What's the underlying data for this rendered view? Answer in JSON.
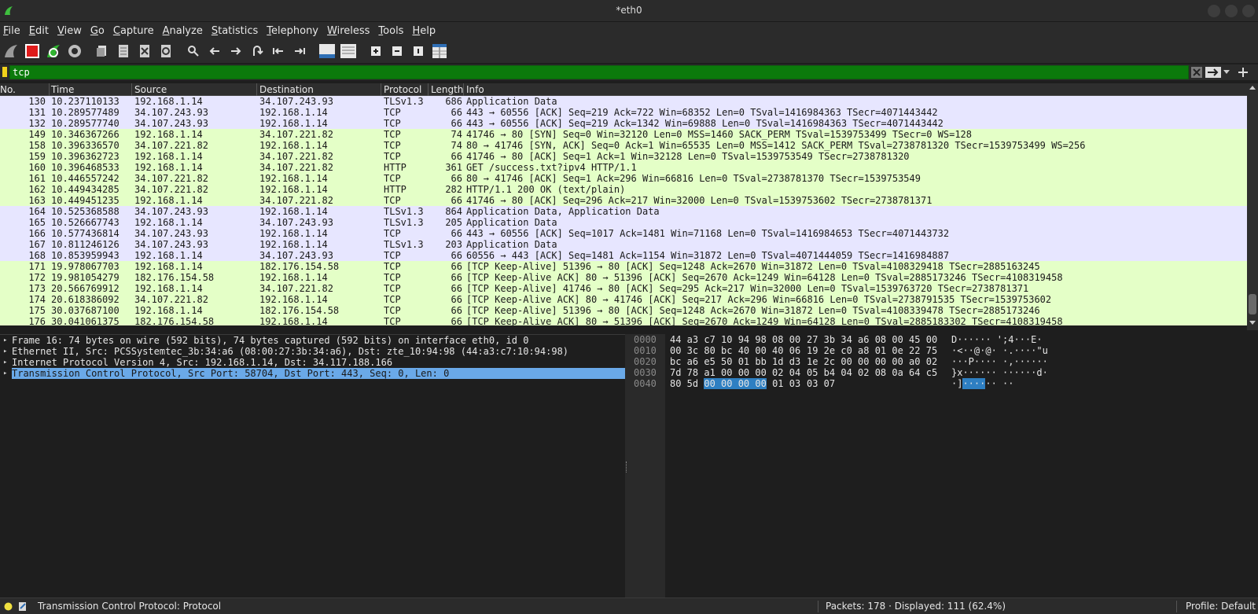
{
  "window": {
    "title": "*eth0"
  },
  "menu": [
    "File",
    "Edit",
    "View",
    "Go",
    "Capture",
    "Analyze",
    "Statistics",
    "Telephony",
    "Wireless",
    "Tools",
    "Help"
  ],
  "menu_underline_index": [
    0,
    0,
    0,
    0,
    0,
    0,
    0,
    0,
    0,
    0,
    0
  ],
  "toolbar": {
    "icons": [
      "shark-fin-start-icon",
      "stop-capture-icon",
      "restart-capture-icon",
      "capture-options-icon",
      "open-file-icon",
      "save-file-icon",
      "close-file-icon",
      "reload-file-icon",
      "find-packet-icon",
      "go-back-icon",
      "go-forward-icon",
      "go-to-packet-icon",
      "go-first-icon",
      "go-last-icon",
      "autoscroll-icon",
      "colorize-icon",
      "zoom-in-icon",
      "zoom-out-icon",
      "normal-size-icon",
      "resize-columns-icon"
    ]
  },
  "filter": {
    "value": "tcp"
  },
  "packet_list": {
    "columns": [
      "No.",
      "Time",
      "Source",
      "Destination",
      "Protocol",
      "Length",
      "Info"
    ],
    "rows": [
      {
        "no": "130",
        "time": "10.237110133",
        "src": "192.168.1.14",
        "dst": "34.107.243.93",
        "proto": "TLSv1.3",
        "len": "686",
        "info": "Application Data",
        "color": "#e7e6ff"
      },
      {
        "no": "131",
        "time": "10.289577489",
        "src": "34.107.243.93",
        "dst": "192.168.1.14",
        "proto": "TCP",
        "len": "66",
        "info": "443 → 60556 [ACK] Seq=219 Ack=722 Win=68352 Len=0 TSval=1416984363 TSecr=4071443442",
        "color": "#e7e6ff"
      },
      {
        "no": "132",
        "time": "10.289577740",
        "src": "34.107.243.93",
        "dst": "192.168.1.14",
        "proto": "TCP",
        "len": "66",
        "info": "443 → 60556 [ACK] Seq=219 Ack=1342 Win=69888 Len=0 TSval=1416984363 TSecr=4071443442",
        "color": "#e7e6ff"
      },
      {
        "no": "149",
        "time": "10.346367266",
        "src": "192.168.1.14",
        "dst": "34.107.221.82",
        "proto": "TCP",
        "len": "74",
        "info": "41746 → 80 [SYN] Seq=0 Win=32120 Len=0 MSS=1460 SACK_PERM TSval=1539753499 TSecr=0 WS=128",
        "color": "#e4ffc7"
      },
      {
        "no": "158",
        "time": "10.396336570",
        "src": "34.107.221.82",
        "dst": "192.168.1.14",
        "proto": "TCP",
        "len": "74",
        "info": "80 → 41746 [SYN, ACK] Seq=0 Ack=1 Win=65535 Len=0 MSS=1412 SACK_PERM TSval=2738781320 TSecr=1539753499 WS=256",
        "color": "#e4ffc7"
      },
      {
        "no": "159",
        "time": "10.396362723",
        "src": "192.168.1.14",
        "dst": "34.107.221.82",
        "proto": "TCP",
        "len": "66",
        "info": "41746 → 80 [ACK] Seq=1 Ack=1 Win=32128 Len=0 TSval=1539753549 TSecr=2738781320",
        "color": "#e4ffc7"
      },
      {
        "no": "160",
        "time": "10.396468533",
        "src": "192.168.1.14",
        "dst": "34.107.221.82",
        "proto": "HTTP",
        "len": "361",
        "info": "GET /success.txt?ipv4 HTTP/1.1",
        "color": "#e4ffc7"
      },
      {
        "no": "161",
        "time": "10.446557242",
        "src": "34.107.221.82",
        "dst": "192.168.1.14",
        "proto": "TCP",
        "len": "66",
        "info": "80 → 41746 [ACK] Seq=1 Ack=296 Win=66816 Len=0 TSval=2738781370 TSecr=1539753549",
        "color": "#e4ffc7"
      },
      {
        "no": "162",
        "time": "10.449434285",
        "src": "34.107.221.82",
        "dst": "192.168.1.14",
        "proto": "HTTP",
        "len": "282",
        "info": "HTTP/1.1 200 OK  (text/plain)",
        "color": "#e4ffc7"
      },
      {
        "no": "163",
        "time": "10.449451235",
        "src": "192.168.1.14",
        "dst": "34.107.221.82",
        "proto": "TCP",
        "len": "66",
        "info": "41746 → 80 [ACK] Seq=296 Ack=217 Win=32000 Len=0 TSval=1539753602 TSecr=2738781371",
        "color": "#e4ffc7"
      },
      {
        "no": "164",
        "time": "10.525368588",
        "src": "34.107.243.93",
        "dst": "192.168.1.14",
        "proto": "TLSv1.3",
        "len": "864",
        "info": "Application Data, Application Data",
        "color": "#e7e6ff"
      },
      {
        "no": "165",
        "time": "10.526667743",
        "src": "192.168.1.14",
        "dst": "34.107.243.93",
        "proto": "TLSv1.3",
        "len": "205",
        "info": "Application Data",
        "color": "#e7e6ff"
      },
      {
        "no": "166",
        "time": "10.577436814",
        "src": "34.107.243.93",
        "dst": "192.168.1.14",
        "proto": "TCP",
        "len": "66",
        "info": "443 → 60556 [ACK] Seq=1017 Ack=1481 Win=71168 Len=0 TSval=1416984653 TSecr=4071443732",
        "color": "#e7e6ff"
      },
      {
        "no": "167",
        "time": "10.811246126",
        "src": "34.107.243.93",
        "dst": "192.168.1.14",
        "proto": "TLSv1.3",
        "len": "203",
        "info": "Application Data",
        "color": "#e7e6ff"
      },
      {
        "no": "168",
        "time": "10.853959943",
        "src": "192.168.1.14",
        "dst": "34.107.243.93",
        "proto": "TCP",
        "len": "66",
        "info": "60556 → 443 [ACK] Seq=1481 Ack=1154 Win=31872 Len=0 TSval=4071444059 TSecr=1416984887",
        "color": "#e7e6ff"
      },
      {
        "no": "171",
        "time": "19.978067703",
        "src": "192.168.1.14",
        "dst": "182.176.154.58",
        "proto": "TCP",
        "len": "66",
        "info": "[TCP Keep-Alive] 51396 → 80 [ACK] Seq=1248 Ack=2670 Win=31872 Len=0 TSval=4108329418 TSecr=2885163245",
        "color": "#e4ffc7"
      },
      {
        "no": "172",
        "time": "19.981054279",
        "src": "182.176.154.58",
        "dst": "192.168.1.14",
        "proto": "TCP",
        "len": "66",
        "info": "[TCP Keep-Alive ACK] 80 → 51396 [ACK] Seq=2670 Ack=1249 Win=64128 Len=0 TSval=2885173246 TSecr=4108319458",
        "color": "#e4ffc7"
      },
      {
        "no": "173",
        "time": "20.566769912",
        "src": "192.168.1.14",
        "dst": "34.107.221.82",
        "proto": "TCP",
        "len": "66",
        "info": "[TCP Keep-Alive] 41746 → 80 [ACK] Seq=295 Ack=217 Win=32000 Len=0 TSval=1539763720 TSecr=2738781371",
        "color": "#e4ffc7"
      },
      {
        "no": "174",
        "time": "20.618386092",
        "src": "34.107.221.82",
        "dst": "192.168.1.14",
        "proto": "TCP",
        "len": "66",
        "info": "[TCP Keep-Alive ACK] 80 → 41746 [ACK] Seq=217 Ack=296 Win=66816 Len=0 TSval=2738791535 TSecr=1539753602",
        "color": "#e4ffc7"
      },
      {
        "no": "175",
        "time": "30.037687100",
        "src": "192.168.1.14",
        "dst": "182.176.154.58",
        "proto": "TCP",
        "len": "66",
        "info": "[TCP Keep-Alive] 51396 → 80 [ACK] Seq=1248 Ack=2670 Win=31872 Len=0 TSval=4108339478 TSecr=2885173246",
        "color": "#e4ffc7"
      },
      {
        "no": "176",
        "time": "30.041061375",
        "src": "182.176.154.58",
        "dst": "192.168.1.14",
        "proto": "TCP",
        "len": "66",
        "info": "[TCP Keep-Alive ACK] 80 → 51396 [ACK] Seq=2670 Ack=1249 Win=64128 Len=0 TSval=2885183302 TSecr=4108319458",
        "color": "#e4ffc7"
      }
    ]
  },
  "details": [
    {
      "text": "Frame 16: 74 bytes on wire (592 bits), 74 bytes captured (592 bits) on interface eth0, id 0",
      "selected": false
    },
    {
      "text": "Ethernet II, Src: PCSSystemtec_3b:34:a6 (08:00:27:3b:34:a6), Dst: zte_10:94:98 (44:a3:c7:10:94:98)",
      "selected": false
    },
    {
      "text": "Internet Protocol Version 4, Src: 192.168.1.14, Dst: 34.117.188.166",
      "selected": false
    },
    {
      "text": "Transmission Control Protocol, Src Port: 58704, Dst Port: 443, Seq: 0, Len: 0",
      "selected": true
    }
  ],
  "bytes": [
    {
      "off": "0000",
      "hex1": "44 a3 c7 10 94 98 08 00",
      "hex2": "27 3b 34 a6 08 00 45 00",
      "asc": "D······ ';4···E·"
    },
    {
      "off": "0010",
      "hex1": "00 3c 80 bc 40 00 40 06",
      "hex2": "19 2e c0 a8 01 0e 22 75",
      "asc": "·<··@·@· ·.····\"u"
    },
    {
      "off": "0020",
      "hex1": "bc a6 e5 50 01 bb 1d d3",
      "hex2": "1e 2c 00 00 00 00 a0 02",
      "asc": "···P···· ·,······"
    },
    {
      "off": "0030",
      "hex1": "7d 78 a1 00 00 00 02 04",
      "hex2": "05 b4 04 02 08 0a 64 c5",
      "asc": "}x······ ······d·"
    },
    {
      "off": "0040",
      "hex1": "80 5d ",
      "hex1_hl": "00 00 00 00",
      "hex1_tail": " 01 03",
      "hex2": "03 07",
      "asc_pre": "·]",
      "asc_hl": "····",
      "asc_post": "·· ··"
    }
  ],
  "status": {
    "left": "Transmission Control Protocol: Protocol",
    "packets": "Packets: 178 · Displayed: 111 (62.4%)",
    "profile": "Profile: Default"
  }
}
